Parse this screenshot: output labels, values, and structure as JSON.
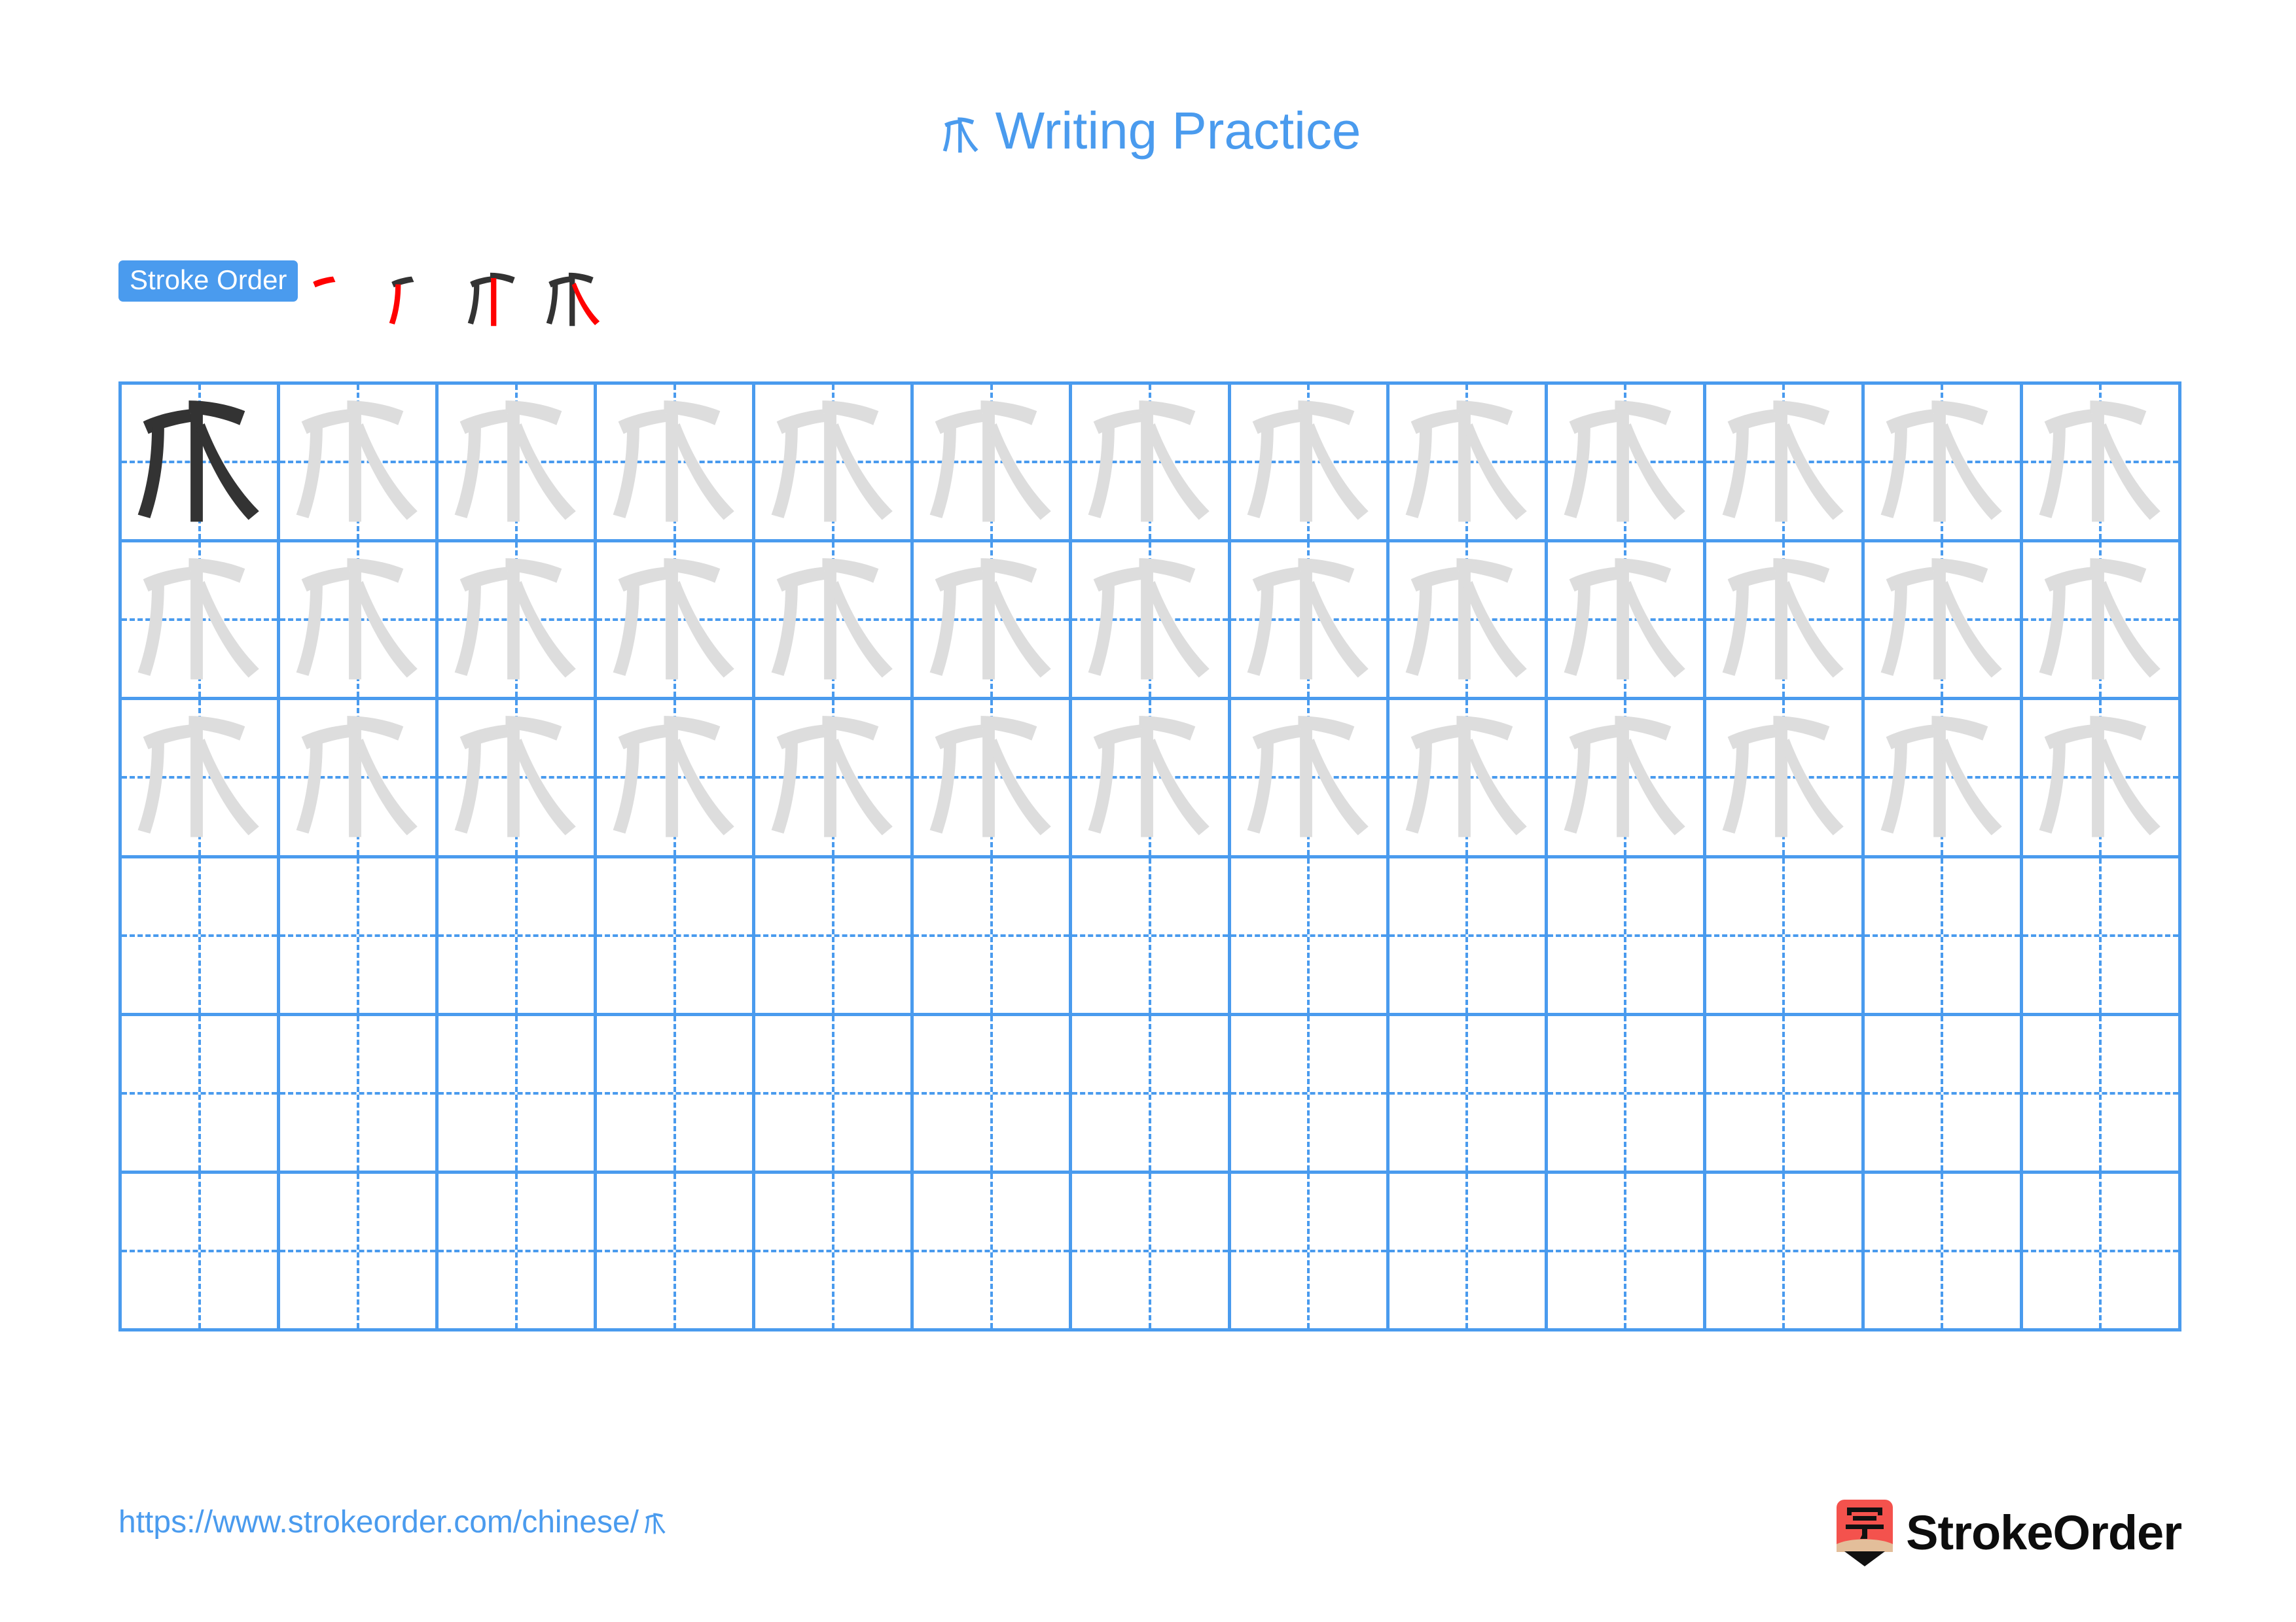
{
  "page": {
    "character": "爪",
    "title_suffix": "Writing Practice",
    "accent_color": "#4A9BEE",
    "stroke_highlight_color": "#FF0000",
    "stroke_done_color": "#333333",
    "trace_color": "#DDDDDD",
    "solid_char_color": "#333333"
  },
  "stroke_order": {
    "badge_label": "Stroke Order",
    "stroke_count": 4,
    "steps": [
      {
        "index": 1,
        "new_stroke": "dian-pie",
        "strokes_shown": 1
      },
      {
        "index": 2,
        "new_stroke": "pie",
        "strokes_shown": 2
      },
      {
        "index": 3,
        "new_stroke": "shu",
        "strokes_shown": 3
      },
      {
        "index": 4,
        "new_stroke": "na",
        "strokes_shown": 4
      }
    ]
  },
  "grid": {
    "columns": 13,
    "rows": 6,
    "filled_rows": 3,
    "empty_rows": 3,
    "first_cell_style": "solid",
    "trace_cell_style": "outline-gray"
  },
  "footer": {
    "url_prefix": "https://www.strokeorder.com/chinese/",
    "url_character": "爪",
    "brand_name": "StrokeOrder",
    "logo_character": "字",
    "logo_body_color": "#F4524D",
    "logo_tip_color": "#E3BE9A",
    "logo_point_color": "#111111"
  }
}
